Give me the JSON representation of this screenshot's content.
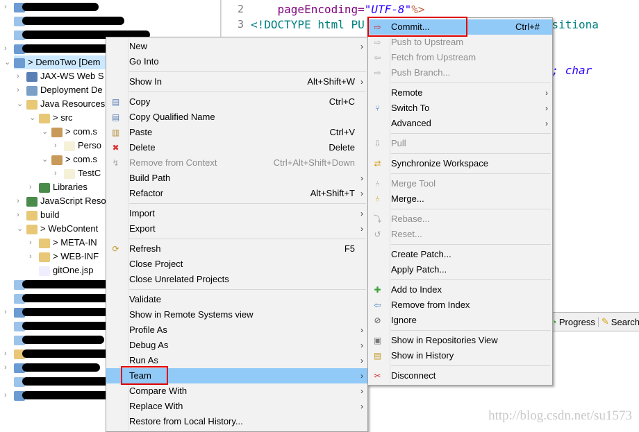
{
  "tree": [
    {
      "label": "",
      "indent": 0,
      "twisty": ">",
      "icon": "web-project-icon",
      "redacted": true
    },
    {
      "label": "",
      "indent": 0,
      "twisty": "",
      "icon": "project-icon",
      "redacted": true
    },
    {
      "label": "",
      "indent": 0,
      "twisty": "",
      "icon": "project-icon",
      "redacted": true
    },
    {
      "label": "",
      "indent": 0,
      "twisty": ">",
      "icon": "web-project-icon",
      "redacted": true
    },
    {
      "label": "> DemoTwo  [Dem",
      "indent": 0,
      "twisty": "v",
      "icon": "web-project-icon",
      "selected": true
    },
    {
      "label": "JAX-WS Web S",
      "indent": 1,
      "twisty": ">",
      "icon": "jaxws-icon"
    },
    {
      "label": "Deployment De",
      "indent": 1,
      "twisty": ">",
      "icon": "deployment-descriptor-icon"
    },
    {
      "label": "Java Resources",
      "indent": 1,
      "twisty": "v",
      "icon": "java-resources-icon"
    },
    {
      "label": "> src",
      "indent": 2,
      "twisty": "v",
      "icon": "source-folder-icon"
    },
    {
      "label": "> com.s",
      "indent": 3,
      "twisty": "v",
      "icon": "package-icon"
    },
    {
      "label": "Perso",
      "indent": 4,
      "twisty": ">",
      "icon": "java-file-icon"
    },
    {
      "label": "> com.s",
      "indent": 3,
      "twisty": "v",
      "icon": "package-icon"
    },
    {
      "label": "TestC",
      "indent": 4,
      "twisty": ">",
      "icon": "java-file-icon"
    },
    {
      "label": "Libraries",
      "indent": 2,
      "twisty": ">",
      "icon": "libraries-icon"
    },
    {
      "label": "JavaScript Reso",
      "indent": 1,
      "twisty": ">",
      "icon": "libraries-icon"
    },
    {
      "label": "build",
      "indent": 1,
      "twisty": ">",
      "icon": "folder-icon"
    },
    {
      "label": "> WebContent",
      "indent": 1,
      "twisty": "v",
      "icon": "folder-icon"
    },
    {
      "label": "> META-IN",
      "indent": 2,
      "twisty": ">",
      "icon": "folder-icon"
    },
    {
      "label": "> WEB-INF",
      "indent": 2,
      "twisty": ">",
      "icon": "folder-icon"
    },
    {
      "label": "gitOne.jsp",
      "indent": 2,
      "twisty": "",
      "icon": "jsp-file-icon"
    },
    {
      "label": "",
      "indent": 0,
      "twisty": "",
      "icon": "project-icon",
      "redacted": true
    },
    {
      "label": "",
      "indent": 0,
      "twisty": "",
      "icon": "project-icon",
      "redacted": true
    },
    {
      "label": "",
      "indent": 0,
      "twisty": ">",
      "icon": "web-project-icon",
      "redacted": true
    },
    {
      "label": "",
      "indent": 0,
      "twisty": "",
      "icon": "project-icon",
      "redacted": true
    },
    {
      "label": "",
      "indent": 0,
      "twisty": "",
      "icon": "project-icon",
      "redacted": true
    },
    {
      "label": "",
      "indent": 0,
      "twisty": ">",
      "icon": "folder-icon",
      "redacted": true
    },
    {
      "label": "",
      "indent": 0,
      "twisty": ">",
      "icon": "web-project-icon",
      "redacted": true
    },
    {
      "label": "",
      "indent": 0,
      "twisty": "",
      "icon": "project-icon",
      "redacted": true
    },
    {
      "label": "",
      "indent": 0,
      "twisty": ">",
      "icon": "web-project-icon",
      "redacted": true
    }
  ],
  "editor": {
    "lines": [
      {
        "num": "2",
        "parts": [
          {
            "t": "    pageEncoding=",
            "c": "#7f007f"
          },
          {
            "t": "\"UTF-8\"",
            "c": "#2a00ff",
            "i": true
          },
          {
            "t": "%>",
            "c": "#bf5f3f"
          }
        ]
      },
      {
        "num": "3",
        "parts": [
          {
            "t": "<!DOCTYPE html PU",
            "c": "#008080"
          },
          {
            "t": "                      ",
            "c": "#000"
          },
          {
            "t": "l Transitiona",
            "c": "#008080"
          }
        ]
      },
      {
        "num": "",
        "parts": [
          {
            "t": "                                      ",
            "c": "#000"
          },
          {
            "t": "xt/html; char",
            "c": "#2a00ff",
            "i": true
          }
        ]
      }
    ]
  },
  "bottom_panel": {
    "tabs": [
      {
        "label": "Progress",
        "icon": "progress-icon"
      },
      {
        "label": "Search",
        "icon": "search-icon"
      }
    ]
  },
  "watermark": "http://blog.csdn.net/su1573",
  "context_menu": [
    {
      "label": "New",
      "arrow": true
    },
    {
      "label": "Go Into"
    },
    {
      "sep": true
    },
    {
      "label": "Show In",
      "shortcut": "Alt+Shift+W",
      "arrow": true
    },
    {
      "sep": true
    },
    {
      "label": "Copy",
      "shortcut": "Ctrl+C",
      "icon": "copy-icon"
    },
    {
      "label": "Copy Qualified Name",
      "icon": "copy-qualified-name-icon"
    },
    {
      "label": "Paste",
      "shortcut": "Ctrl+V",
      "icon": "paste-icon"
    },
    {
      "label": "Delete",
      "shortcut": "Delete",
      "icon": "delete-icon"
    },
    {
      "label": "Remove from Context",
      "shortcut": "Ctrl+Alt+Shift+Down",
      "icon": "remove-context-icon",
      "disabled": true
    },
    {
      "label": "Build Path",
      "arrow": true
    },
    {
      "label": "Refactor",
      "shortcut": "Alt+Shift+T",
      "arrow": true
    },
    {
      "sep": true
    },
    {
      "label": "Import",
      "arrow": true
    },
    {
      "label": "Export",
      "arrow": true
    },
    {
      "sep": true
    },
    {
      "label": "Refresh",
      "shortcut": "F5",
      "icon": "refresh-icon"
    },
    {
      "label": "Close Project"
    },
    {
      "label": "Close Unrelated Projects"
    },
    {
      "sep": true
    },
    {
      "label": "Validate"
    },
    {
      "label": "Show in Remote Systems view"
    },
    {
      "label": "Profile As",
      "arrow": true
    },
    {
      "label": "Debug As",
      "arrow": true
    },
    {
      "label": "Run As",
      "arrow": true
    },
    {
      "label": "Team",
      "arrow": true,
      "highlighted": true
    },
    {
      "label": "Compare With",
      "arrow": true
    },
    {
      "label": "Replace With",
      "arrow": true
    },
    {
      "label": "Restore from Local History..."
    }
  ],
  "team_submenu": [
    {
      "label": "Commit...",
      "shortcut": "Ctrl+#",
      "icon": "commit-icon",
      "highlighted": true
    },
    {
      "label": "Push to Upstream",
      "icon": "push-icon",
      "disabled": true
    },
    {
      "label": "Fetch from Upstream",
      "icon": "fetch-icon",
      "disabled": true
    },
    {
      "label": "Push Branch...",
      "icon": "push-branch-icon",
      "disabled": true
    },
    {
      "sep": true
    },
    {
      "label": "Remote",
      "arrow": true
    },
    {
      "label": "Switch To",
      "arrow": true,
      "icon": "branch-icon"
    },
    {
      "label": "Advanced",
      "arrow": true
    },
    {
      "sep": true
    },
    {
      "label": "Pull",
      "icon": "pull-icon",
      "disabled": true
    },
    {
      "sep": true
    },
    {
      "label": "Synchronize Workspace",
      "icon": "synchronize-icon"
    },
    {
      "sep": true
    },
    {
      "label": "Merge Tool",
      "icon": "merge-tool-icon",
      "disabled": true
    },
    {
      "label": "Merge...",
      "icon": "merge-icon"
    },
    {
      "sep": true
    },
    {
      "label": "Rebase...",
      "icon": "rebase-icon",
      "disabled": true
    },
    {
      "label": "Reset...",
      "icon": "reset-icon",
      "disabled": true
    },
    {
      "sep": true
    },
    {
      "label": "Create Patch..."
    },
    {
      "label": "Apply Patch..."
    },
    {
      "sep": true
    },
    {
      "label": "Add to Index",
      "icon": "add-index-icon"
    },
    {
      "label": "Remove from Index",
      "icon": "remove-index-icon"
    },
    {
      "label": "Ignore",
      "icon": "ignore-icon"
    },
    {
      "sep": true
    },
    {
      "label": "Show in Repositories View",
      "icon": "repositories-icon"
    },
    {
      "label": "Show in History",
      "icon": "history-icon"
    },
    {
      "sep": true
    },
    {
      "label": "Disconnect",
      "icon": "disconnect-icon"
    }
  ],
  "colors": {
    "highlight": "#91c9f7",
    "selection": "#cce8ff",
    "callout": "#e00000"
  }
}
